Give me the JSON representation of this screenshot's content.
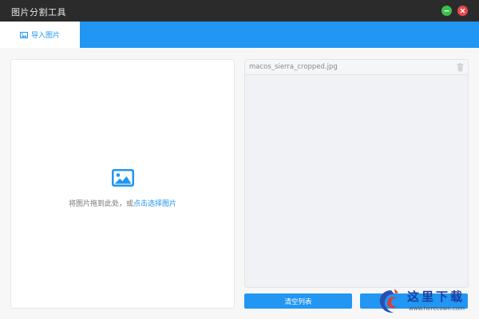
{
  "window": {
    "title": "图片分割工具"
  },
  "tabs": [
    {
      "label": "导入图片",
      "active": true
    }
  ],
  "dropzone": {
    "text_prefix": "将图片拖到此处，或",
    "link_text": "点击选择图片"
  },
  "file_list": {
    "items": [
      {
        "name": "macos_sierra_cropped.jpg"
      }
    ]
  },
  "buttons": {
    "clear_label": "清空列表",
    "split_label": ""
  },
  "watermark": {
    "text": "这里下载",
    "url": "www.herecown.com"
  },
  "colors": {
    "accent": "#2196f3",
    "titlebar": "#2b2b2b",
    "minimize": "#3cbf4b",
    "close": "#e8474c"
  },
  "icons": {
    "tab": "image-icon",
    "drop": "image-icon",
    "delete": "trash-icon"
  }
}
